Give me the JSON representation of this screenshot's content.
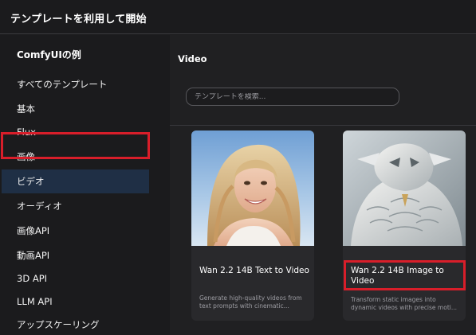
{
  "header": {
    "title": "テンプレートを利用して開始"
  },
  "sidebar": {
    "section_title": "ComfyUIの例",
    "items": [
      {
        "label": "すべてのテンプレート"
      },
      {
        "label": "基本"
      },
      {
        "label": "Flux"
      },
      {
        "label": "画像"
      },
      {
        "label": "ビデオ",
        "selected": true
      },
      {
        "label": "オーディオ"
      },
      {
        "label": "画像API"
      },
      {
        "label": "動画API"
      },
      {
        "label": "3D API"
      },
      {
        "label": "LLM API"
      },
      {
        "label": "アップスケーリング"
      }
    ]
  },
  "main": {
    "category_title": "Video",
    "search": {
      "placeholder": "テンプレートを検索..."
    },
    "cards": [
      {
        "title": "Wan 2.2 14B Text to Video",
        "description": "Generate high-quality videos from text prompts with cinematic..."
      },
      {
        "title": "Wan 2.2 14B Image to Video",
        "description": "Transform static images into dynamic videos with precise moti..."
      }
    ]
  },
  "colors": {
    "background": "#1b1b1d",
    "selected_item": "#1f2f45",
    "highlight_border": "#d81e2a",
    "card_background": "#29292c"
  }
}
